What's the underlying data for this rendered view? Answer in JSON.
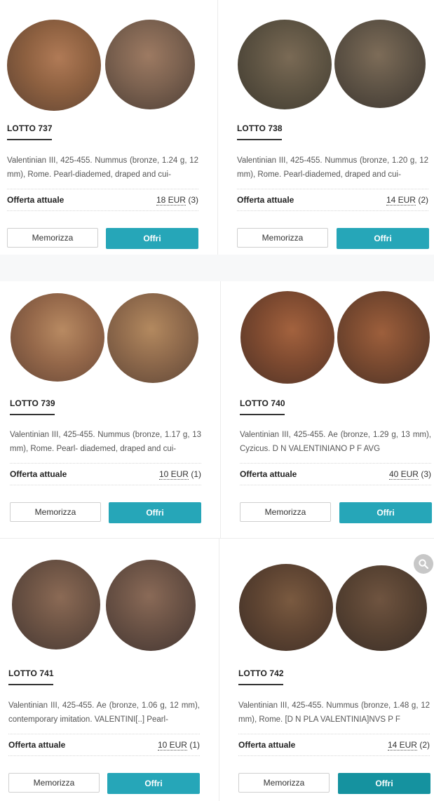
{
  "labels": {
    "offer": "Offerta attuale",
    "save": "Memorizza",
    "bid": "Offri",
    "currency": "EUR"
  },
  "lots": [
    {
      "title": "LOTTO 737",
      "desc": "Valentinian III, 425-455. Nummus (bronze, 1.24 g, 12 mm), Rome. Pearl-diademed, draped and cui-",
      "price": "18",
      "bids": "(3)"
    },
    {
      "title": "LOTTO 738",
      "desc": "Valentinian III, 425-455. Nummus (bronze, 1.20 g, 12 mm), Rome. Pearl-diademed, draped and cui-",
      "price": "14",
      "bids": "(2)"
    },
    {
      "title": "LOTTO 739",
      "desc": "Valentinian III, 425-455. Nummus (bronze, 1.17 g, 13 mm), Rome. Pearl- diademed, draped and cui-",
      "price": "10",
      "bids": "(1)"
    },
    {
      "title": "LOTTO 740",
      "desc": "Valentinian III, 425-455. Ae (bronze, 1.29 g, 13 mm), Cyzicus. D N VALENTINIANO P F AVG",
      "price": "40",
      "bids": "(3)"
    },
    {
      "title": "LOTTO 741",
      "desc": "Valentinian III, 425-455. Ae (bronze, 1.06 g, 12 mm), contemporary imitation. VALENTINI[..] Pearl-",
      "price": "10",
      "bids": "(1)"
    },
    {
      "title": "LOTTO 742",
      "desc": "Valentinian III, 425-455. Nummus (bronze, 1.48 g, 12 mm), Rome. [D N PLA VALENTINIA]NVS P F",
      "price": "14",
      "bids": "(2)"
    }
  ]
}
